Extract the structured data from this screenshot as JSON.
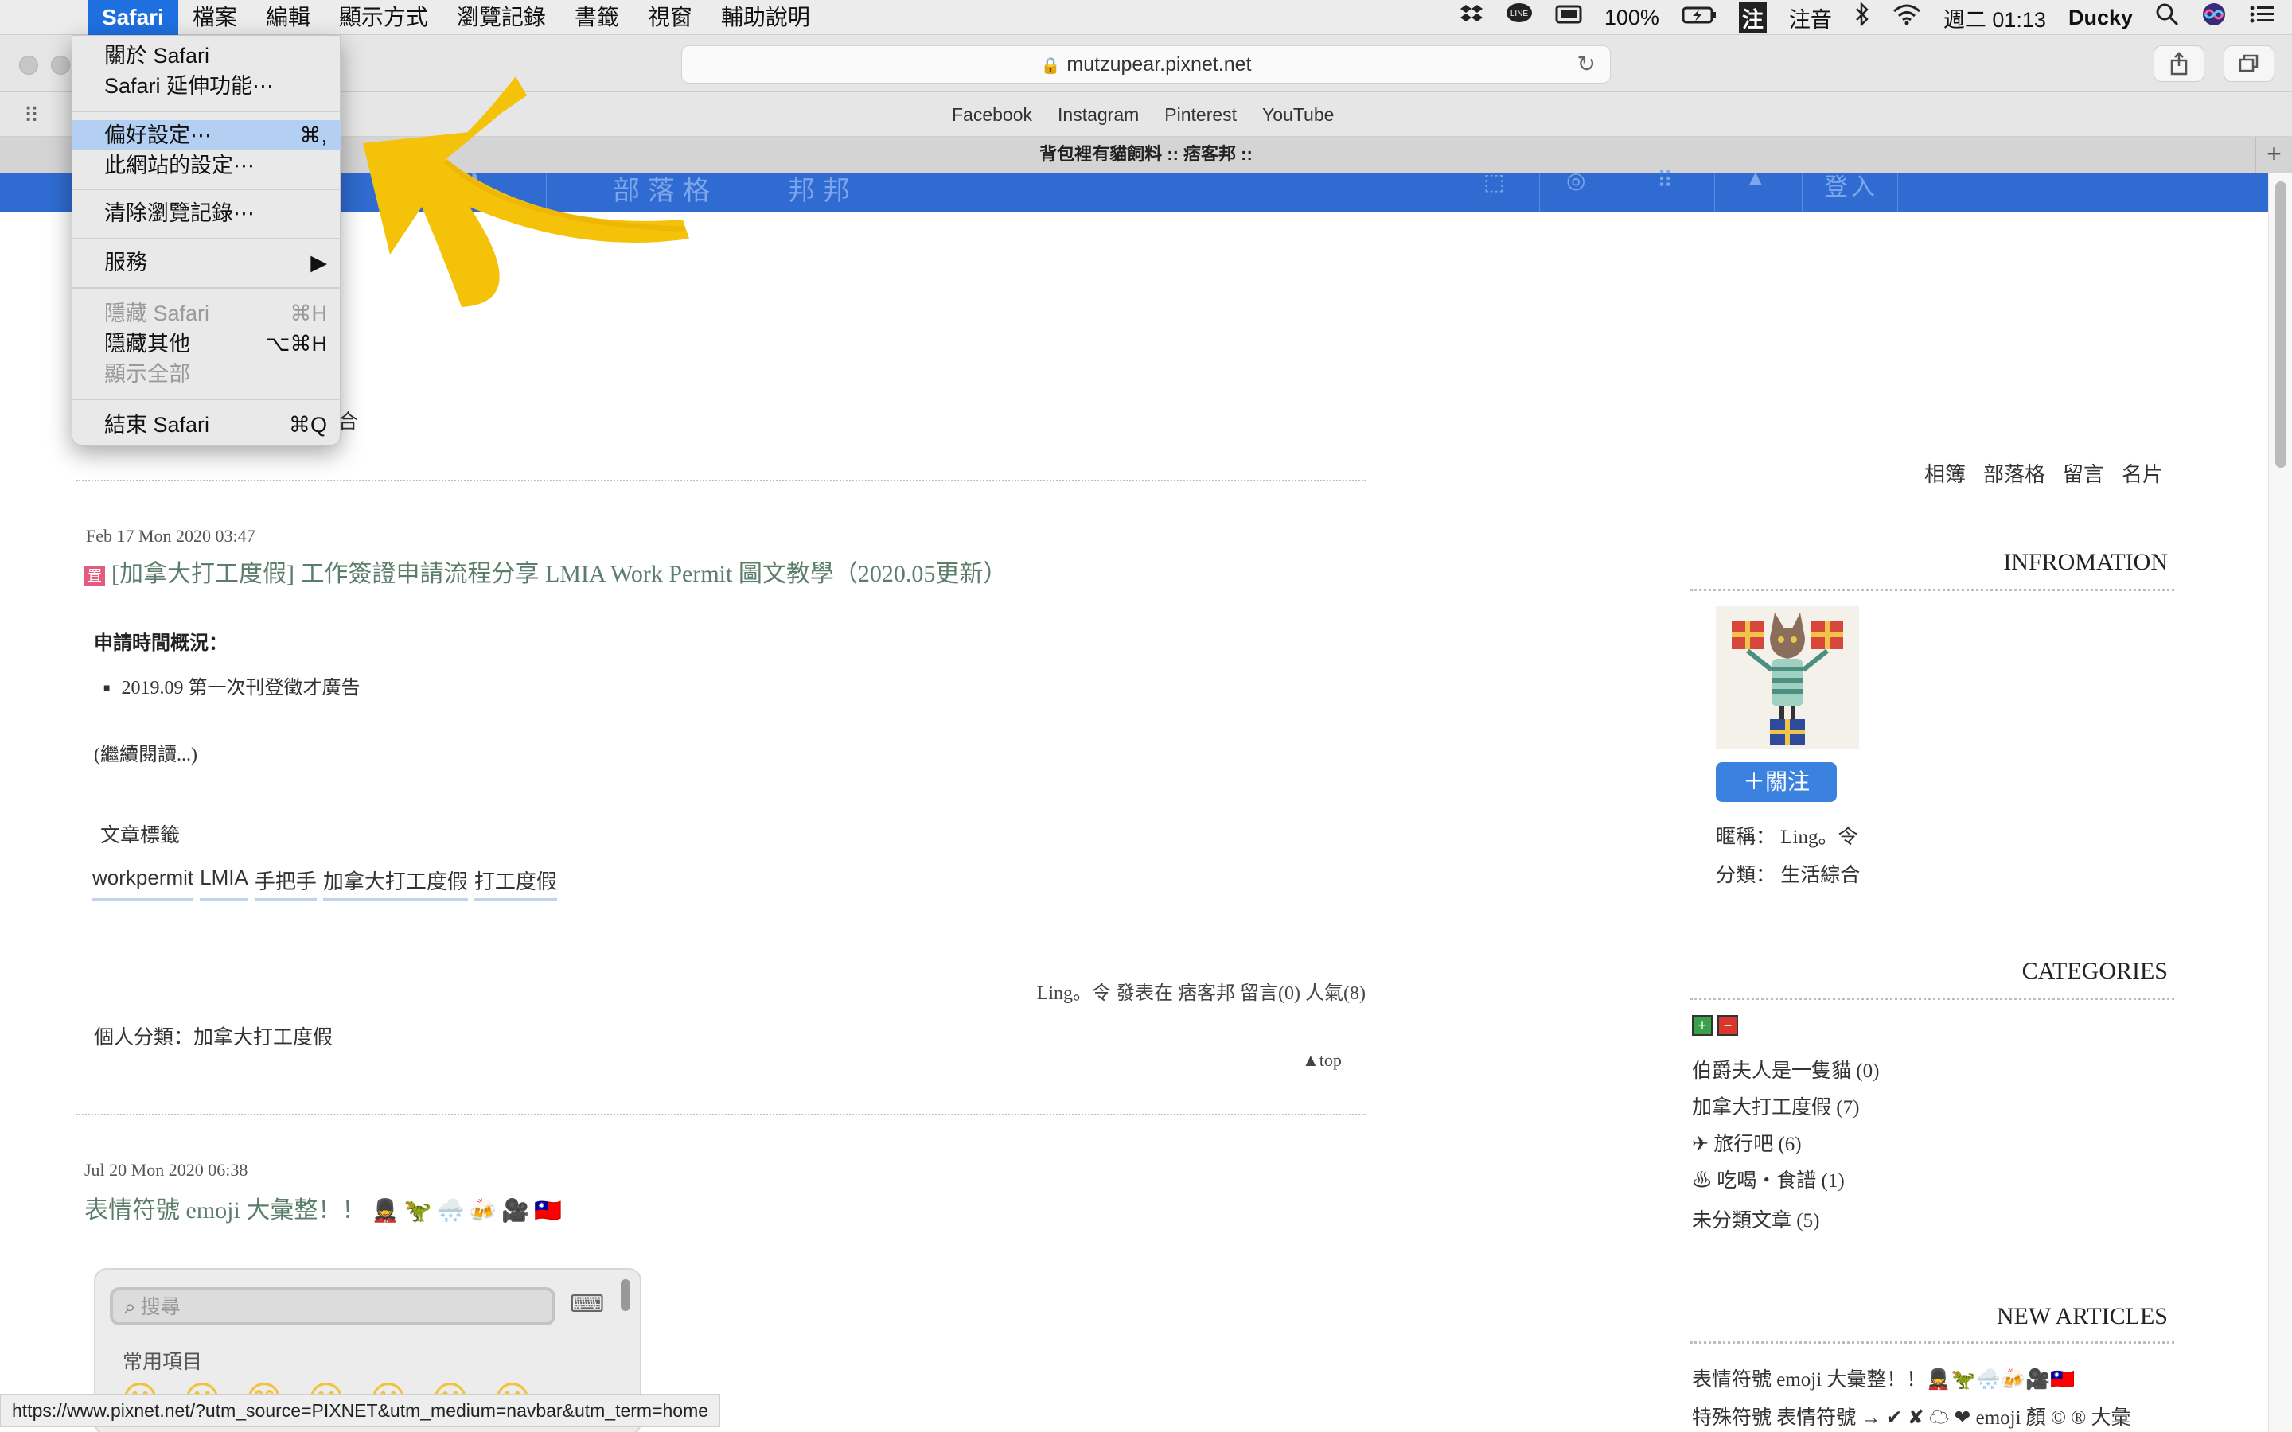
{
  "menubar": {
    "apple_icon": "apple-logo",
    "items": [
      "Safari",
      "檔案",
      "編輯",
      "顯示方式",
      "瀏覽記錄",
      "書籤",
      "視窗",
      "輔助說明"
    ],
    "status": {
      "battery": "100%",
      "ime_badge": "注",
      "ime_label": "注音",
      "clock": "週二 01:13",
      "user": "Ducky"
    }
  },
  "safari": {
    "address": "mutzupear.pixnet.net",
    "favorites": [
      "Facebook",
      "Instagram",
      "Pinterest",
      "YouTube"
    ],
    "tab_title": "背包裡有貓飼料 :: 痞客邦 ::",
    "new_tab": "+"
  },
  "safari_menu": {
    "items": [
      {
        "label": "關於 Safari",
        "shortcut": ""
      },
      {
        "label": "Safari 延伸功能⋯",
        "shortcut": ""
      },
      {
        "label": "偏好設定⋯",
        "shortcut": "⌘,"
      },
      {
        "label": "此網站的設定⋯",
        "shortcut": ""
      },
      {
        "label": "清除瀏覽記錄⋯",
        "shortcut": ""
      },
      {
        "label": "服務",
        "shortcut": "▶"
      },
      {
        "label": "隱藏 Safari",
        "shortcut": "⌘H"
      },
      {
        "label": "隱藏其他",
        "shortcut": "⌥⌘H"
      },
      {
        "label": "顯示全部",
        "shortcut": ""
      },
      {
        "label": "結束 Safari",
        "shortcut": "⌘Q"
      }
    ]
  },
  "pixnet_nav": {
    "items": [
      "部落格",
      "邦邦"
    ],
    "login": "登入"
  },
  "stray_char": "合",
  "posts": [
    {
      "date": "Feb 17 Mon 2020 03:47",
      "sticky_icon": "置",
      "title": "[加拿大打工度假] 工作簽證申請流程分享 LMIA Work Permit 圖文教學（2020.05更新）",
      "section_label": "申請時間概況：",
      "bullet": "2019.09 第一次刊登徵才廣告",
      "read_more": "(繼續閱讀...)",
      "tags_title": "文章標籤",
      "tags": [
        "workpermit",
        "LMIA",
        "手把手",
        "加拿大打工度假",
        "打工度假"
      ],
      "meta": "Ling。令 發表在 痞客邦 留言(0) 人氣(8)",
      "category": "個人分類：加拿大打工度假",
      "top_label": "▲top"
    },
    {
      "date": "Jul 20 Mon 2020 06:38",
      "title": "表情符號 emoji 大彙整！！",
      "title_emoji": "💂🦖🌨️🍻🎥🇹🇼"
    }
  ],
  "emoji_picker": {
    "search_placeholder": "搜尋",
    "section": "常用項目",
    "faces": "😀😀😅😀😀😐😀"
  },
  "status_url": "https://www.pixnet.net/?utm_source=PIXNET&utm_medium=navbar&utm_term=home",
  "sidebar": {
    "links": [
      "相簿",
      "部落格",
      "留言",
      "名片"
    ],
    "info_title": "INFROMATION",
    "follow_label": "＋關注",
    "nickname": "暱稱： Ling。令",
    "category": "分類： 生活綜合",
    "categories_title": "CATEGORIES",
    "categories": [
      "伯爵夫人是一隻貓 (0)",
      "加拿大打工度假 (7)",
      "✈ 旅行吧 (6)",
      "♨ 吃喝・食譜 (1)",
      "未分類文章 (5)"
    ],
    "new_articles_title": "NEW ARTICLES",
    "new_articles": [
      "表情符號 emoji 大彙整！！💂🦖🌨️🍻🎥🇹🇼",
      "特殊符號 表情符號 → ✔ ✘ ☁ ❤ emoji 顏 © ® 大彙"
    ]
  },
  "colors": {
    "accent": "#1e6fe0",
    "pixnet_blue": "#2f6bd0",
    "title_green": "#5b7d6b",
    "arrow_yellow": "#f5c20a"
  }
}
